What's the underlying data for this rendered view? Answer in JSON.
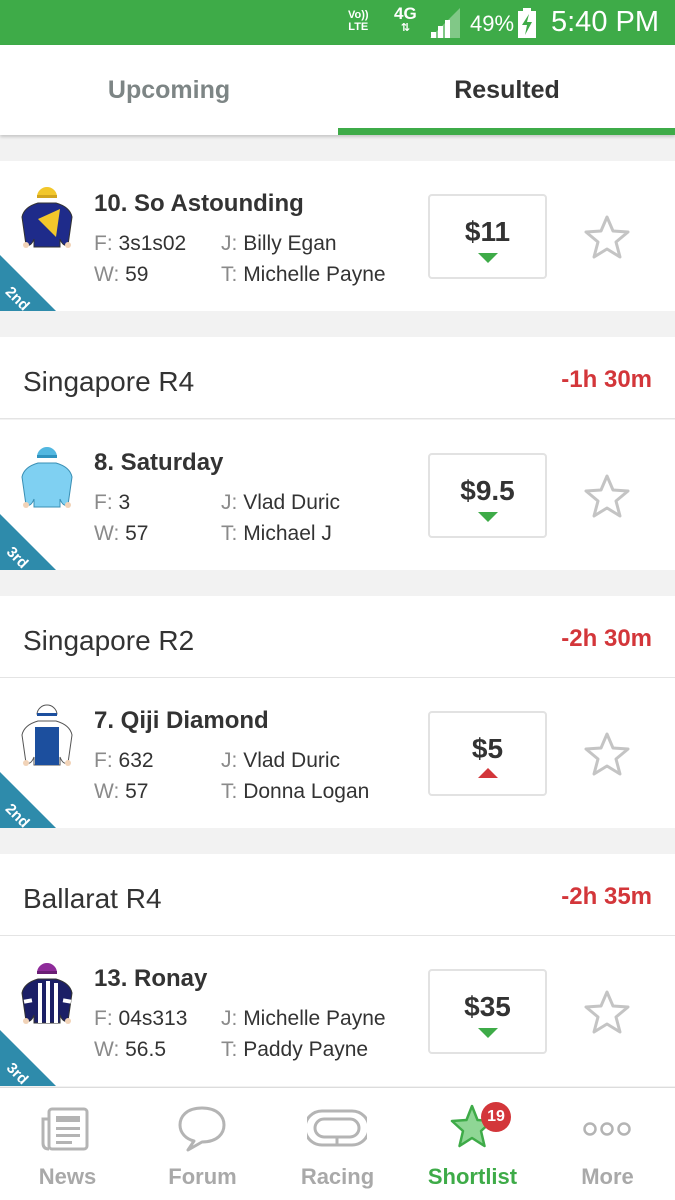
{
  "status_bar": {
    "volte_line1": "Vo))",
    "volte_line2": "LTE",
    "network": "4G",
    "network_arrows": "⇅",
    "battery_percent": "49%",
    "time": "5:40 PM"
  },
  "tabs": [
    {
      "label": "Upcoming",
      "active": false
    },
    {
      "label": "Resulted",
      "active": true
    }
  ],
  "races": [
    {
      "runner": {
        "name": "10. So Astounding",
        "form_label": "F:",
        "form": "3s1s02",
        "jockey_label": "J:",
        "jockey": "Billy Egan",
        "weight_label": "W:",
        "weight": "59",
        "trainer_label": "T:",
        "trainer": "Michelle Payne",
        "odds": "$11",
        "odds_trend": "down",
        "placing": "2nd"
      }
    },
    {
      "name": "Singapore R4",
      "time": "-1h 30m",
      "runner": {
        "name": "8. Saturday",
        "form_label": "F:",
        "form": "3",
        "jockey_label": "J:",
        "jockey": "Vlad Duric",
        "weight_label": "W:",
        "weight": "57",
        "trainer_label": "T:",
        "trainer": "Michael J",
        "odds": "$9.5",
        "odds_trend": "down",
        "placing": "3rd"
      }
    },
    {
      "name": "Singapore R2",
      "time": "-2h 30m",
      "runner": {
        "name": "7. Qiji Diamond",
        "form_label": "F:",
        "form": "632",
        "jockey_label": "J:",
        "jockey": "Vlad Duric",
        "weight_label": "W:",
        "weight": "57",
        "trainer_label": "T:",
        "trainer": "Donna Logan",
        "odds": "$5",
        "odds_trend": "up",
        "placing": "2nd"
      }
    },
    {
      "name": "Ballarat R4",
      "time": "-2h 35m",
      "runner": {
        "name": "13. Ronay",
        "form_label": "F:",
        "form": "04s313",
        "jockey_label": "J:",
        "jockey": "Michelle Payne",
        "weight_label": "W:",
        "weight": "56.5",
        "trainer_label": "T:",
        "trainer": "Paddy Payne",
        "odds": "$35",
        "odds_trend": "down",
        "placing": "3rd"
      }
    }
  ],
  "bottom_nav": [
    {
      "label": "News",
      "icon": "news-icon",
      "active": false
    },
    {
      "label": "Forum",
      "icon": "chat-bubble-icon",
      "active": false
    },
    {
      "label": "Racing",
      "icon": "racetrack-icon",
      "active": false
    },
    {
      "label": "Shortlist",
      "icon": "star-icon",
      "active": true,
      "badge": "19"
    },
    {
      "label": "More",
      "icon": "more-dots-icon",
      "active": false
    }
  ],
  "colors": {
    "brand_green": "#3eab48",
    "time_red": "#d3363a",
    "placing_teal": "#2e8bab"
  }
}
